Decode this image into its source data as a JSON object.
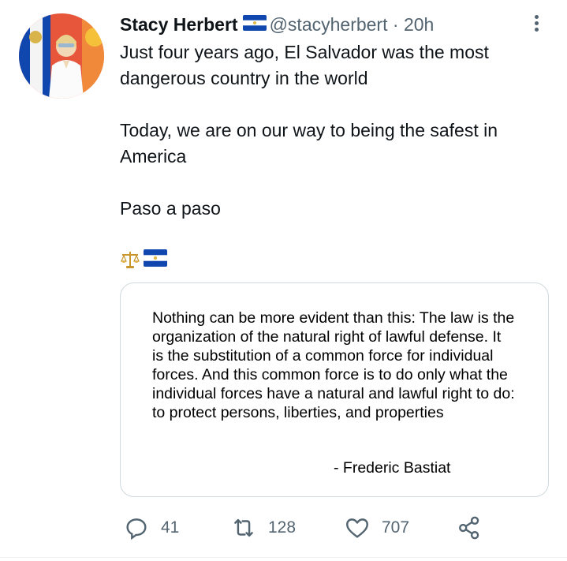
{
  "tweet": {
    "author_name": "Stacy Herbert",
    "handle": "@stacyherbert",
    "separator": "·",
    "time": "20h",
    "text_p1": "Just four years ago, El Salvador was the most dangerous country in the world",
    "text_p2": "Today, we are on our way to being the safest in America",
    "text_p3": "Paso a paso",
    "emoji_line": [
      "scales-emoji",
      "el-salvador-flag-emoji"
    ],
    "colors": {
      "text": "#0f1419",
      "muted": "#536471",
      "border": "#cfd9de",
      "flag_blue": "#0f47af"
    }
  },
  "card": {
    "quote": "Nothing can be more evident than this: The law is the organization of the natural right of lawful defense. It is the substitution of a common force for individual forces. And this common force is to do only what the individual forces have a natural and lawful right to do: to protect persons, liberties, and properties",
    "author": "- Frederic Bastiat"
  },
  "actions": {
    "reply_count": "41",
    "retweet_count": "128",
    "like_count": "707"
  }
}
